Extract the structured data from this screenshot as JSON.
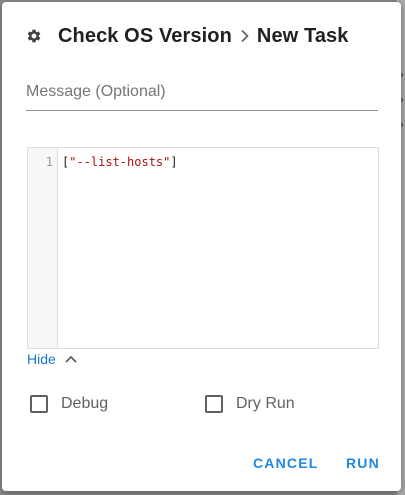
{
  "dialog": {
    "title": "Check OS Version",
    "subtitle": "New Task",
    "icon": "gear-icon",
    "separator_icon": "chevron-right-icon"
  },
  "message": {
    "placeholder": "Message (Optional)",
    "value": ""
  },
  "editor": {
    "line_numbers": [
      "1"
    ],
    "code_open": "[",
    "code_string": "\"--list-hosts\"",
    "code_close": "]"
  },
  "toggle": {
    "label": "Hide",
    "icon": "chevron-up-icon"
  },
  "options": {
    "debug_label": "Debug",
    "debug_checked": false,
    "dry_run_label": "Dry Run",
    "dry_run_checked": false
  },
  "actions": {
    "cancel_label": "CANCEL",
    "run_label": "RUN"
  },
  "colors": {
    "accent": "#1e88e5",
    "link": "#1976d2",
    "overlay": "#8a8a8a"
  }
}
